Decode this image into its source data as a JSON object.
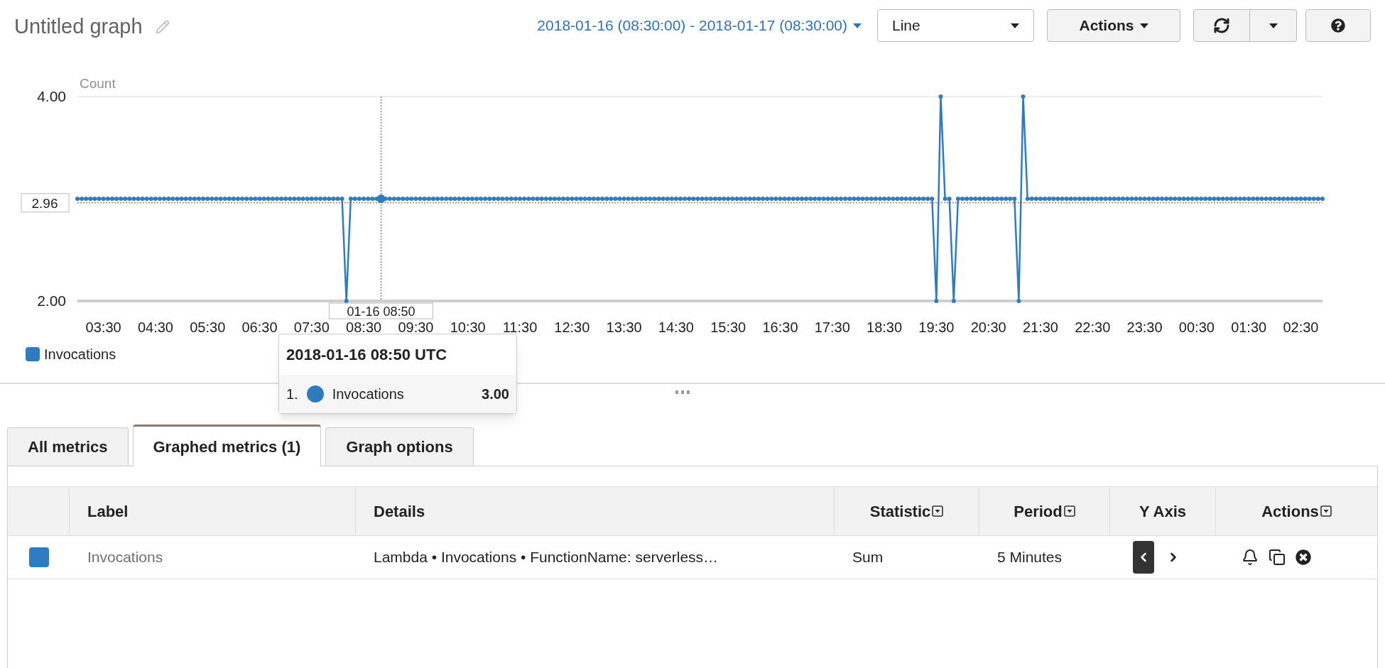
{
  "header": {
    "title": "Untitled graph",
    "time_range": "2018-01-16 (08:30:00) - 2018-01-17 (08:30:00)",
    "graph_type": "Line",
    "actions": "Actions"
  },
  "chart": {
    "crosshair": {
      "time_label": "01-16 08:50",
      "value_label": "2.96"
    },
    "chart_data": {
      "type": "line",
      "ylabel": "Count",
      "ylim": [
        2,
        4
      ],
      "yticks": [
        {
          "value": 2,
          "label": "2.00"
        },
        {
          "value": 4,
          "label": "4.00"
        }
      ],
      "categories": [
        null,
        null,
        null,
        null,
        null,
        null,
        "03:30",
        null,
        null,
        null,
        null,
        null,
        null,
        null,
        null,
        null,
        null,
        null,
        "04:30",
        null,
        null,
        null,
        null,
        null,
        null,
        null,
        null,
        null,
        null,
        null,
        "05:30",
        null,
        null,
        null,
        null,
        null,
        null,
        null,
        null,
        null,
        null,
        null,
        "06:30",
        null,
        null,
        null,
        null,
        null,
        null,
        null,
        null,
        null,
        null,
        null,
        "07:30",
        null,
        null,
        null,
        null,
        null,
        null,
        null,
        null,
        null,
        null,
        null,
        "08:30",
        null,
        null,
        null,
        null,
        null,
        null,
        null,
        null,
        null,
        null,
        null,
        "09:30",
        null,
        null,
        null,
        null,
        null,
        null,
        null,
        null,
        null,
        null,
        null,
        "10:30",
        null,
        null,
        null,
        null,
        null,
        null,
        null,
        null,
        null,
        null,
        null,
        "11:30",
        null,
        null,
        null,
        null,
        null,
        null,
        null,
        null,
        null,
        null,
        null,
        "12:30",
        null,
        null,
        null,
        null,
        null,
        null,
        null,
        null,
        null,
        null,
        null,
        "13:30",
        null,
        null,
        null,
        null,
        null,
        null,
        null,
        null,
        null,
        null,
        null,
        "14:30",
        null,
        null,
        null,
        null,
        null,
        null,
        null,
        null,
        null,
        null,
        null,
        "15:30",
        null,
        null,
        null,
        null,
        null,
        null,
        null,
        null,
        null,
        null,
        null,
        "16:30",
        null,
        null,
        null,
        null,
        null,
        null,
        null,
        null,
        null,
        null,
        null,
        "17:30",
        null,
        null,
        null,
        null,
        null,
        null,
        null,
        null,
        null,
        null,
        null,
        "18:30",
        null,
        null,
        null,
        null,
        null,
        null,
        null,
        null,
        null,
        null,
        null,
        "19:30",
        null,
        null,
        null,
        null,
        null,
        null,
        null,
        null,
        null,
        null,
        null,
        "20:30",
        null,
        null,
        null,
        null,
        null,
        null,
        null,
        null,
        null,
        null,
        null,
        "21:30",
        null,
        null,
        null,
        null,
        null,
        null,
        null,
        null,
        null,
        null,
        null,
        "22:30",
        null,
        null,
        null,
        null,
        null,
        null,
        null,
        null,
        null,
        null,
        null,
        "23:30",
        null,
        null,
        null,
        null,
        null,
        null,
        null,
        null,
        null,
        null,
        null,
        "00:30",
        null,
        null,
        null,
        null,
        null,
        null,
        null,
        null,
        null,
        null,
        null,
        "01:30",
        null,
        null,
        null,
        null,
        null,
        null,
        null,
        null,
        null,
        null,
        null,
        "02:30",
        null,
        null,
        null,
        null,
        null
      ],
      "series": [
        {
          "name": "Invocations",
          "color": "#2e7bbf",
          "marker": "circle",
          "values": [
            3,
            3,
            3,
            3,
            3,
            3,
            3,
            3,
            3,
            3,
            3,
            3,
            3,
            3,
            3,
            3,
            3,
            3,
            3,
            3,
            3,
            3,
            3,
            3,
            3,
            3,
            3,
            3,
            3,
            3,
            3,
            3,
            3,
            3,
            3,
            3,
            3,
            3,
            3,
            3,
            3,
            3,
            3,
            3,
            3,
            3,
            3,
            3,
            3,
            3,
            3,
            3,
            3,
            3,
            3,
            3,
            3,
            3,
            3,
            3,
            3,
            3,
            2,
            3,
            3,
            3,
            3,
            3,
            3,
            3,
            3,
            3,
            3,
            3,
            3,
            3,
            3,
            3,
            3,
            3,
            3,
            3,
            3,
            3,
            3,
            3,
            3,
            3,
            3,
            3,
            3,
            3,
            3,
            3,
            3,
            3,
            3,
            3,
            3,
            3,
            3,
            3,
            3,
            3,
            3,
            3,
            3,
            3,
            3,
            3,
            3,
            3,
            3,
            3,
            3,
            3,
            3,
            3,
            3,
            3,
            3,
            3,
            3,
            3,
            3,
            3,
            3,
            3,
            3,
            3,
            3,
            3,
            3,
            3,
            3,
            3,
            3,
            3,
            3,
            3,
            3,
            3,
            3,
            3,
            3,
            3,
            3,
            3,
            3,
            3,
            3,
            3,
            3,
            3,
            3,
            3,
            3,
            3,
            3,
            3,
            3,
            3,
            3,
            3,
            3,
            3,
            3,
            3,
            3,
            3,
            3,
            3,
            3,
            3,
            3,
            3,
            3,
            3,
            3,
            3,
            3,
            3,
            3,
            3,
            3,
            3,
            3,
            3,
            3,
            3,
            3,
            3,
            3,
            3,
            3,
            3,
            3,
            3,
            2,
            4,
            3,
            3,
            2,
            3,
            3,
            3,
            3,
            3,
            3,
            3,
            3,
            3,
            3,
            3,
            3,
            3,
            3,
            2,
            4,
            3,
            3,
            3,
            3,
            3,
            3,
            3,
            3,
            3,
            3,
            3,
            3,
            3,
            3,
            3,
            3,
            3,
            3,
            3,
            3,
            3,
            3,
            3,
            3,
            3,
            3,
            3,
            3,
            3,
            3,
            3,
            3,
            3,
            3,
            3,
            3,
            3,
            3,
            3,
            3,
            3,
            3,
            3,
            3,
            3,
            3,
            3,
            3,
            3,
            3,
            3,
            3,
            3,
            3,
            3,
            3,
            3,
            3,
            3,
            3,
            3,
            3,
            3,
            3,
            3,
            3,
            3,
            3,
            3
          ]
        }
      ]
    }
  },
  "tooltip": {
    "title": "2018-01-16 08:50 UTC",
    "rows": [
      {
        "index": "1.",
        "name": "Invocations",
        "value": "3.00",
        "color": "#2e7bbf"
      }
    ]
  },
  "tabs": [
    {
      "label": "All metrics",
      "selected": false
    },
    {
      "label": "Graphed metrics (1)",
      "selected": true
    },
    {
      "label": "Graph options",
      "selected": false
    }
  ],
  "table": {
    "columns": [
      {
        "label": "Label",
        "menu": false
      },
      {
        "label": "Details",
        "menu": false
      },
      {
        "label": "Statistic",
        "menu": true
      },
      {
        "label": "Period",
        "menu": true
      },
      {
        "label": "Y Axis",
        "menu": false
      },
      {
        "label": "Actions",
        "menu": true
      }
    ],
    "rows": [
      {
        "color": "#2e7bbf",
        "label": "Invocations",
        "details": "Lambda • Invocations • FunctionName: serverless…",
        "statistic": "Sum",
        "period": "5 Minutes",
        "y_axis": [
          {
            "selected": true
          },
          {
            "selected": false
          }
        ]
      }
    ]
  }
}
